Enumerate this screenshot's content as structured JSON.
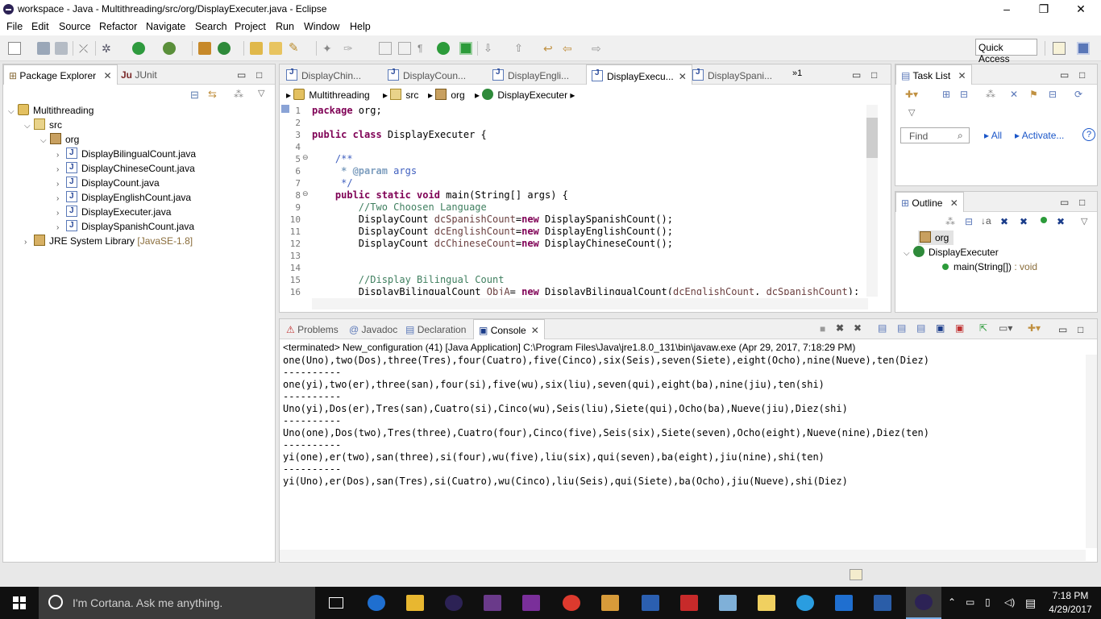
{
  "window": {
    "title": "workspace - Java - Multithreading/src/org/DisplayExecuter.java - Eclipse",
    "min": "–",
    "max": "❐",
    "close": "✕"
  },
  "menu": [
    "File",
    "Edit",
    "Source",
    "Refactor",
    "Navigate",
    "Search",
    "Project",
    "Run",
    "Window",
    "Help"
  ],
  "quick_access": "Quick Access",
  "package_explorer": {
    "tabs": [
      "Package Explorer",
      "JUnit"
    ],
    "project": "Multithreading",
    "src": "src",
    "package": "org",
    "files": [
      "DisplayBilingualCount.java",
      "DisplayChineseCount.java",
      "DisplayCount.java",
      "DisplayEnglishCount.java",
      "DisplayExecuter.java",
      "DisplaySpanishCount.java"
    ],
    "jre": "JRE System Library",
    "jre_version": "[JavaSE-1.8]"
  },
  "editor": {
    "tabs": [
      "DisplayChin...",
      "DisplayCoun...",
      "DisplayEngli...",
      "DisplayExecu...",
      "DisplaySpani..."
    ],
    "overflow": "»1",
    "breadcrumb": [
      "Multithreading",
      "src",
      "org",
      "DisplayExecuter"
    ],
    "line_numbers": [
      "1",
      "2",
      "3",
      "4",
      "5",
      "6",
      "7",
      "8",
      "9",
      "10",
      "11",
      "12",
      "13",
      "14",
      "15",
      "16"
    ],
    "lines": [
      {
        "a": "package",
        "b": " org;"
      },
      {
        "a": "",
        "b": ""
      },
      {
        "a": "public class",
        "b": " DisplayExecuter {"
      },
      {
        "a": "",
        "b": ""
      },
      {
        "a": "    /**",
        "b": ""
      },
      {
        "a": "     * @param",
        "b": " args"
      },
      {
        "a": "     */",
        "b": ""
      },
      {
        "a": "    public static void",
        "b": " main(String[] args) {"
      },
      {
        "a": "        //Two Choosen Language",
        "b": ""
      },
      {
        "a": "        DisplayCount ",
        "b": "dcSpanishCount",
        "c": "=",
        "d": "new",
        "e": " DisplaySpanishCount();"
      },
      {
        "a": "        DisplayCount ",
        "b": "dcEnglishCount",
        "c": "=",
        "d": "new",
        "e": " DisplayEnglishCount();"
      },
      {
        "a": "        DisplayCount ",
        "b": "dcChineseCount",
        "c": "=",
        "d": "new",
        "e": " DisplayChineseCount();"
      },
      {
        "a": "",
        "b": ""
      },
      {
        "a": "",
        "b": ""
      },
      {
        "a": "        //Display Bilingual Count",
        "b": ""
      },
      {
        "a": "        DisplayBilingualCount ",
        "b": "ObjA",
        "c": "= ",
        "d": "new",
        "e": " DisplayBilingualCount(",
        "f": "dcEnglishCount",
        "g": ", ",
        "h": "dcSpanishCount",
        "i": ");"
      }
    ]
  },
  "task_list": {
    "tab": "Task List",
    "find_placeholder": "Find",
    "all": "All",
    "activate": "Activate...",
    "help": "?"
  },
  "outline": {
    "tab": "Outline",
    "package": "org",
    "class": "DisplayExecuter",
    "method": "main(String[])",
    "method_type": " : void"
  },
  "console": {
    "tabs": [
      "Problems",
      "Javadoc",
      "Declaration",
      "Console"
    ],
    "header": "<terminated> New_configuration (41) [Java Application] C:\\Program Files\\Java\\jre1.8.0_131\\bin\\javaw.exe (Apr 29, 2017, 7:18:29 PM)",
    "lines": [
      "one(Uno),two(Dos),three(Tres),four(Cuatro),five(Cinco),six(Seis),seven(Siete),eight(Ocho),nine(Nueve),ten(Diez)",
      "----------",
      "one(yi),two(er),three(san),four(si),five(wu),six(liu),seven(qui),eight(ba),nine(jiu),ten(shi)",
      "----------",
      "Uno(yi),Dos(er),Tres(san),Cuatro(si),Cinco(wu),Seis(liu),Siete(qui),Ocho(ba),Nueve(jiu),Diez(shi)",
      "----------",
      "Uno(one),Dos(two),Tres(three),Cuatro(four),Cinco(five),Seis(six),Siete(seven),Ocho(eight),Nueve(nine),Diez(ten)",
      "----------",
      "yi(one),er(two),san(three),si(four),wu(five),liu(six),qui(seven),ba(eight),jiu(nine),shi(ten)",
      "----------",
      "yi(Uno),er(Dos),san(Tres),si(Cuatro),wu(Cinco),liu(Seis),qui(Siete),ba(Ocho),jiu(Nueve),shi(Diez)"
    ]
  },
  "taskbar": {
    "cortana": "I'm Cortana. Ask me anything.",
    "time": "7:18 PM",
    "date": "4/29/2017"
  }
}
